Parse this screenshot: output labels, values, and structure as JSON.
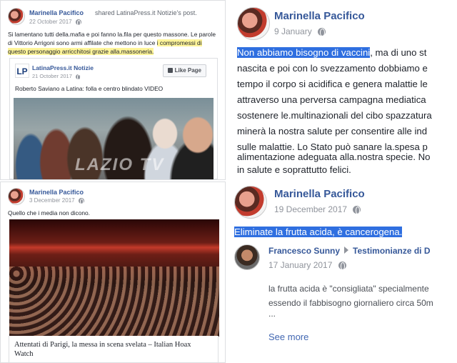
{
  "top_left": {
    "author": "Marinella Pacifico",
    "shared_text": "shared LatinaPress.it Notizie's post.",
    "date": "22 October 2017",
    "text_lines": [
      "Si lamentano tutti della.mafia e poi fanno la.fila per questo massone. Le parole",
      "di Vittorio Arrigoni sono armi affilate che mettono in luce",
      "i compromessi di",
      "questo personaggio arricchitosi grazie alla.massoneria."
    ],
    "shared_page": {
      "logo": "LP",
      "name": "LatinaPress.it Notizie",
      "date": "21 October 2017",
      "like_button": "Like Page",
      "post_text": "Roberto Saviano a Latina: folla e centro blindato VIDEO",
      "watermark": "LAZIO TV"
    }
  },
  "bottom_left": {
    "author": "Marinella Pacifico",
    "date": "3 December 2017",
    "text": "Quello che i media non dicono.",
    "link_title_lines": [
      "Attentati di Parigi, la messa in scena svelata – Italian Hoax",
      "Watch"
    ]
  },
  "top_right": {
    "author": "Marinella Pacifico",
    "date": "9 January",
    "highlighted": "Non abbiamo bisogno di vaccini",
    "lines": [
      ", ma di uno st",
      "nascita e poi con lo svezzamento dobbiamo e",
      "tempo il corpo si acidifica e genera malattie le",
      "attraverso una perversa campagna mediatica",
      "sostenere le.multinazionali del cibo spazzatura",
      "minerà la nostra salute per consentire alle ind",
      "sulle malattie. Lo Stato può sanare la.spesa p",
      "alimentazione adeguata alla.nostra specie. No",
      "in salute e soprattutto felici."
    ]
  },
  "bottom_right": {
    "author": "Marinella Pacifico",
    "date": "19 December 2017",
    "highlighted": "Eliminate la frutta acida, è cancerogena.",
    "comment": {
      "author": "Francesco Sunny",
      "target": "Testimonianze di D",
      "date": "17 January 2017",
      "lines": [
        "la frutta acida è \"consigliata\" specialmente",
        "essendo il fabbisogno giornaliero circa 50m",
        "..."
      ],
      "see_more": "See more"
    }
  },
  "colors": {
    "name_blue": "#365899",
    "highlight_yellow": "#fff59a",
    "highlight_blue": "#2f6fe0",
    "meta_gray": "#90949c"
  },
  "icons": [
    "globe-icon",
    "arrow-right-icon"
  ]
}
